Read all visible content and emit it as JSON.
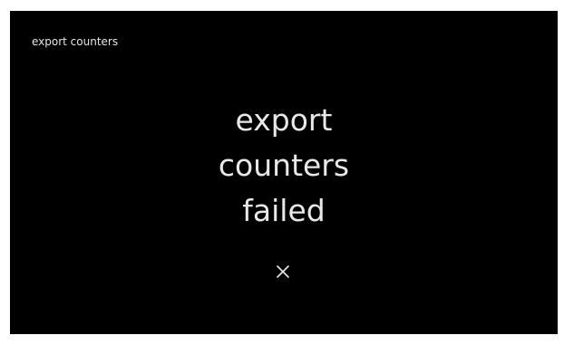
{
  "header": {
    "title": "export counters"
  },
  "dialog": {
    "message_lines": [
      "export",
      "counters",
      "failed"
    ],
    "close_icon": "close-icon"
  },
  "colors": {
    "screen_background": "#000000",
    "text": "#e8e8e8",
    "frame": "#ffffff"
  }
}
